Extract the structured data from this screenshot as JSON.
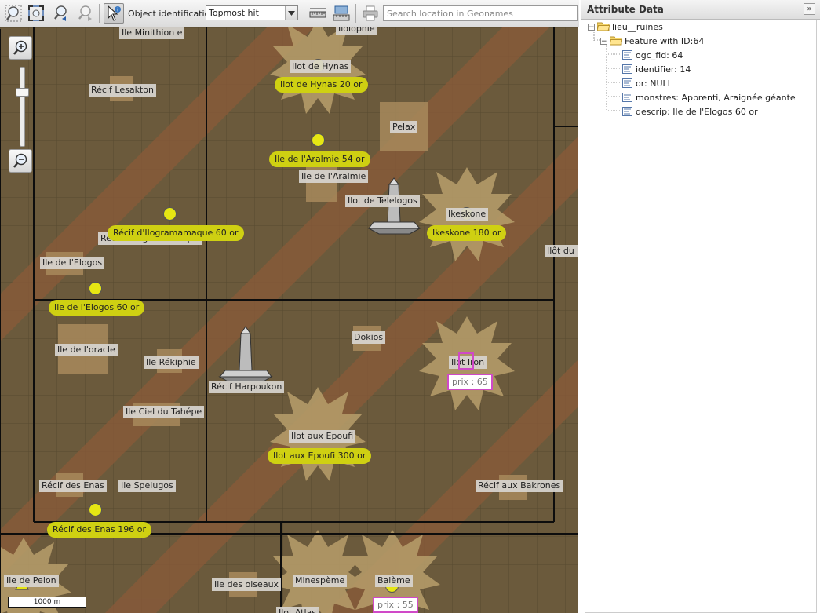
{
  "toolbar": {
    "object_identification_label": "Object identification:",
    "object_identification_value": "Topmost hit",
    "search_placeholder": "Search location in Geonames"
  },
  "map": {
    "scale_label": "1000 m",
    "colors": {
      "terrain": "#6b5a3c",
      "stripe": "#8a5a39",
      "pill": "#cfd012",
      "dot": "#e6e613",
      "price_border": "#d049c8"
    },
    "labels": [
      "Ile Minithion e",
      "Ilolophie",
      "Ilot de Hynas",
      "Récif Lesakton",
      "Pelax",
      "Ile de l'Aralmie",
      "Ilot de Telelogos",
      "Ikeskone",
      "Ilôt du S",
      "Récif d'Ilogramamaque",
      "Ile de l'Elogos",
      "Dokios",
      "Ile de l'oracle",
      "Ile Rékiphie",
      "Ilot Iron",
      "Récif Harpoukon",
      "Ile Ciel du Tahépe",
      "Ilot aux Epoufi",
      "Récif des Enas",
      "Ile Spelugos",
      "Récif aux Bakrones",
      "Ile de Pelon",
      "Ile des oiseaux",
      "Minespème",
      "Balème",
      "Ilot Atlas"
    ],
    "pills": [
      "Ilot de Hynas   20 or",
      "Ile de l'Aralmie    54 or",
      "Récif d'Ilogramamaque   60 or",
      "Ikeskone    180 or",
      "Ile de l'Elogos     60 or",
      "Ilot aux Epoufi     300 or",
      "Récif des Enas   196 or"
    ],
    "prices": [
      "prix : 65",
      "prix : 55"
    ]
  },
  "attribute_panel": {
    "title": "Attribute Data",
    "collapse_glyph": "»",
    "layer": "lieu__ruines",
    "feature": "Feature with ID:64",
    "attributes": [
      "ogc_fid: 64",
      "identifier: 14",
      "or: NULL",
      "monstres: Apprenti, Araignée géante",
      "descrip: Ile de l'Elogos 60 or"
    ]
  }
}
